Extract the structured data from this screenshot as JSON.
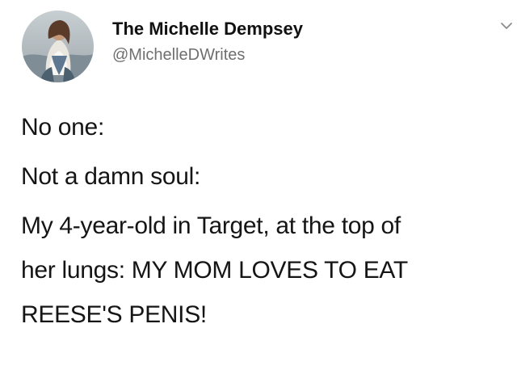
{
  "tweet": {
    "author": {
      "display_name": "The Michelle Dempsey",
      "handle": "@MichelleDWrites",
      "avatar_icon": "profile-photo"
    },
    "menu_icon": "chevron-down-icon",
    "body": {
      "line_1": "No one:",
      "line_2": "Not a damn soul:",
      "line_3": "My 4-year-old in Target, at the top of",
      "line_4": "her lungs: MY MOM LOVES TO EAT",
      "line_5": "REESE'S PENIS!"
    }
  }
}
